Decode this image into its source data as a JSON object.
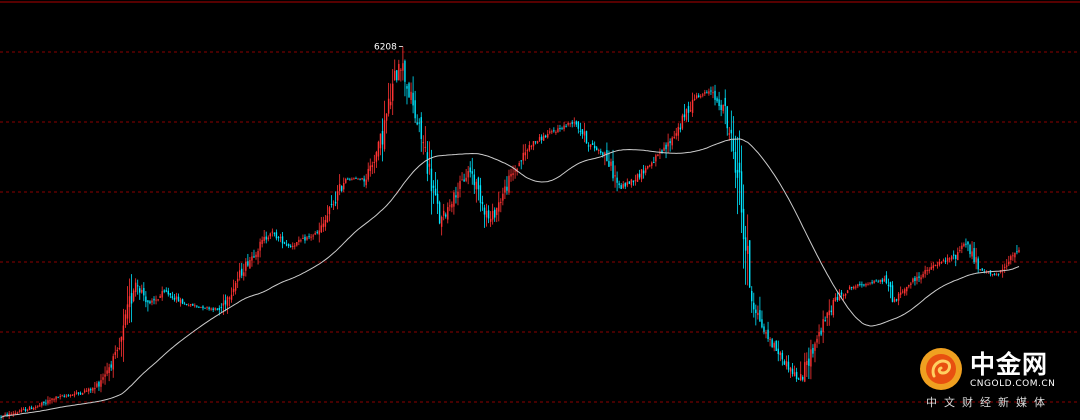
{
  "chart_data": {
    "type": "candlestick",
    "annotations": [
      {
        "text": "6208",
        "anchor": "peak-high"
      }
    ],
    "ylim": [
      2450,
      6800
    ],
    "x_count": 500,
    "grid": true,
    "moving_average": true,
    "colors": {
      "background": "#000000",
      "up": "#ff3333",
      "down": "#00e5ff",
      "moving_average": "#cccccc",
      "grid": "#8b0000",
      "text": "#ffffff"
    },
    "price_path": [
      [
        0,
        2480
      ],
      [
        40,
        2600
      ],
      [
        55,
        2680
      ],
      [
        75,
        2720
      ],
      [
        95,
        2780
      ],
      [
        120,
        3180
      ],
      [
        135,
        3900
      ],
      [
        150,
        3640
      ],
      [
        165,
        3780
      ],
      [
        185,
        3650
      ],
      [
        220,
        3590
      ],
      [
        245,
        4050
      ],
      [
        270,
        4400
      ],
      [
        290,
        4250
      ],
      [
        320,
        4400
      ],
      [
        345,
        4950
      ],
      [
        365,
        4950
      ],
      [
        380,
        5300
      ],
      [
        400,
        6210
      ],
      [
        415,
        5600
      ],
      [
        425,
        5250
      ],
      [
        440,
        4480
      ],
      [
        450,
        4700
      ],
      [
        470,
        5050
      ],
      [
        490,
        4500
      ],
      [
        510,
        4950
      ],
      [
        530,
        5300
      ],
      [
        550,
        5420
      ],
      [
        575,
        5550
      ],
      [
        590,
        5300
      ],
      [
        605,
        5200
      ],
      [
        620,
        4850
      ],
      [
        635,
        4950
      ],
      [
        650,
        5100
      ],
      [
        665,
        5250
      ],
      [
        680,
        5500
      ],
      [
        695,
        5800
      ],
      [
        710,
        5850
      ],
      [
        725,
        5650
      ],
      [
        738,
        5000
      ],
      [
        745,
        4300
      ],
      [
        752,
        3700
      ],
      [
        765,
        3350
      ],
      [
        785,
        3050
      ],
      [
        800,
        2850
      ],
      [
        815,
        3250
      ],
      [
        835,
        3700
      ],
      [
        850,
        3820
      ],
      [
        865,
        3860
      ],
      [
        885,
        3900
      ],
      [
        895,
        3680
      ],
      [
        910,
        3870
      ],
      [
        935,
        4050
      ],
      [
        955,
        4150
      ],
      [
        965,
        4300
      ],
      [
        980,
        4000
      ],
      [
        1000,
        3950
      ],
      [
        1020,
        4250
      ]
    ]
  },
  "watermark": {
    "name_cn": "中金网",
    "domain": "CNGOLD.COM.CN",
    "tagline": "中文财经新媒体"
  }
}
